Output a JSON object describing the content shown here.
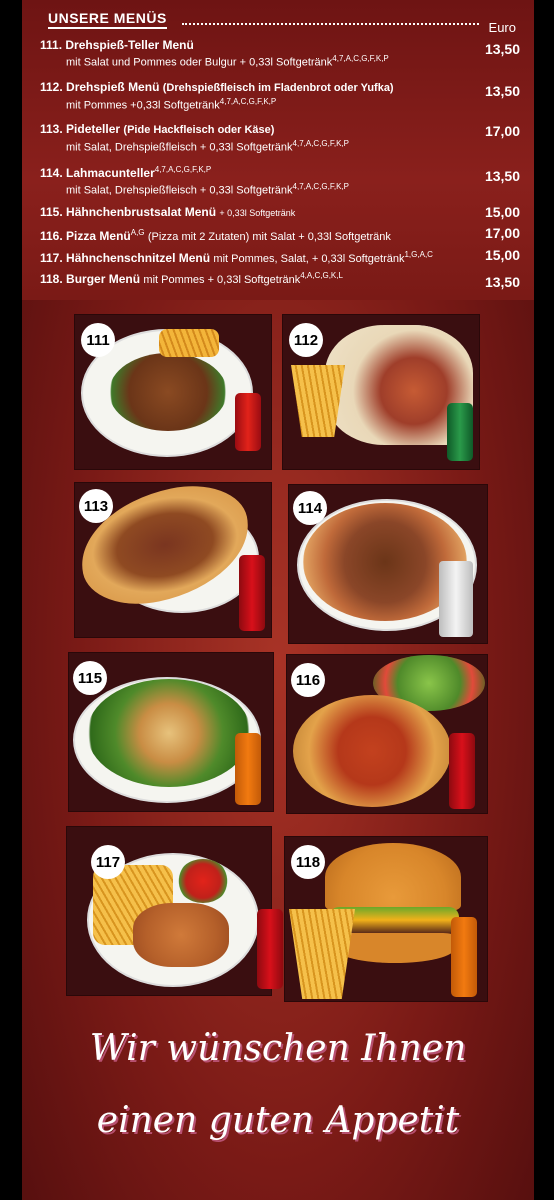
{
  "header": {
    "title": "UNSERE MENÜS",
    "currency": "Euro"
  },
  "items": [
    {
      "num": "111.",
      "name": "Drehspieß-Teller Menü",
      "desc": "mit Salat und Pommes oder Bulgur + 0,33l Softgetränk",
      "sup": "4,7,A,C,G,F,K,P",
      "price": "13,50"
    },
    {
      "num": "112.",
      "name": "Drehspieß Menü",
      "desc": "(Drehspießfleisch im Fladenbrot oder Yufka)",
      "desc2": "mit Pommes +0,33l Softgetränk",
      "sup": "4,7,A,C,G,F,K,P",
      "price": "13,50"
    },
    {
      "num": "113.",
      "name": "Pideteller",
      "desc": "(Pide Hackfleisch oder Käse)",
      "desc2": "mit Salat, Drehspießfleisch + 0,33l Softgetränk",
      "sup": "4,7,A,C,G,F,K,P",
      "price": "17,00"
    },
    {
      "num": "114.",
      "name": "Lahmacunteller",
      "sup0": "4,7,A,C,G,F,K,P",
      "desc2": "mit Salat, Drehspießfleisch + 0,33l Softgetränk",
      "sup": "4,7,A,C,G,F,K,P",
      "price": "13,50"
    },
    {
      "num": "115.",
      "name": "Hähnchenbrustsalat Menü",
      "desc": "+ 0,33l Softgetränk",
      "price": "15,00"
    },
    {
      "num": "116.",
      "name": "Pizza Menü",
      "sup0": "A,G",
      "desc": "(Pizza mit 2 Zutaten) mit Salat + 0,33l Softgetränk",
      "price": "17,00"
    },
    {
      "num": "117.",
      "name": "Hähnchenschnitzel Menü",
      "desc": "mit Pommes, Salat, + 0,33l Softgetränk",
      "sup": "1,G,A,C",
      "price": "15,00"
    },
    {
      "num": "118.",
      "name": "Burger Menü",
      "desc": "mit Pommes + 0,33l Softgetränk",
      "sup": "4,A,C,G,K,L",
      "price": "13,50"
    }
  ],
  "photos": [
    {
      "badge": "111",
      "drink": "mezzo mix"
    },
    {
      "badge": "112",
      "drink": "Sprite"
    },
    {
      "badge": "113",
      "drink": "Coca-Cola"
    },
    {
      "badge": "114",
      "drink": "Ayran"
    },
    {
      "badge": "115",
      "drink": "Fanta"
    },
    {
      "badge": "116",
      "drink": "Coca-Cola"
    },
    {
      "badge": "117",
      "drink": "Coca-Cola"
    },
    {
      "badge": "118",
      "drink": "Fanta"
    }
  ],
  "closing": {
    "line1": "Wir wünschen Ihnen",
    "line2": "einen guten Appetit"
  },
  "colors": {
    "background": "#7a1a16",
    "coke": "#d8101a",
    "fanta": "#f27a10",
    "sprite": "#1d7a3a",
    "mezzo": "#e2231a"
  }
}
